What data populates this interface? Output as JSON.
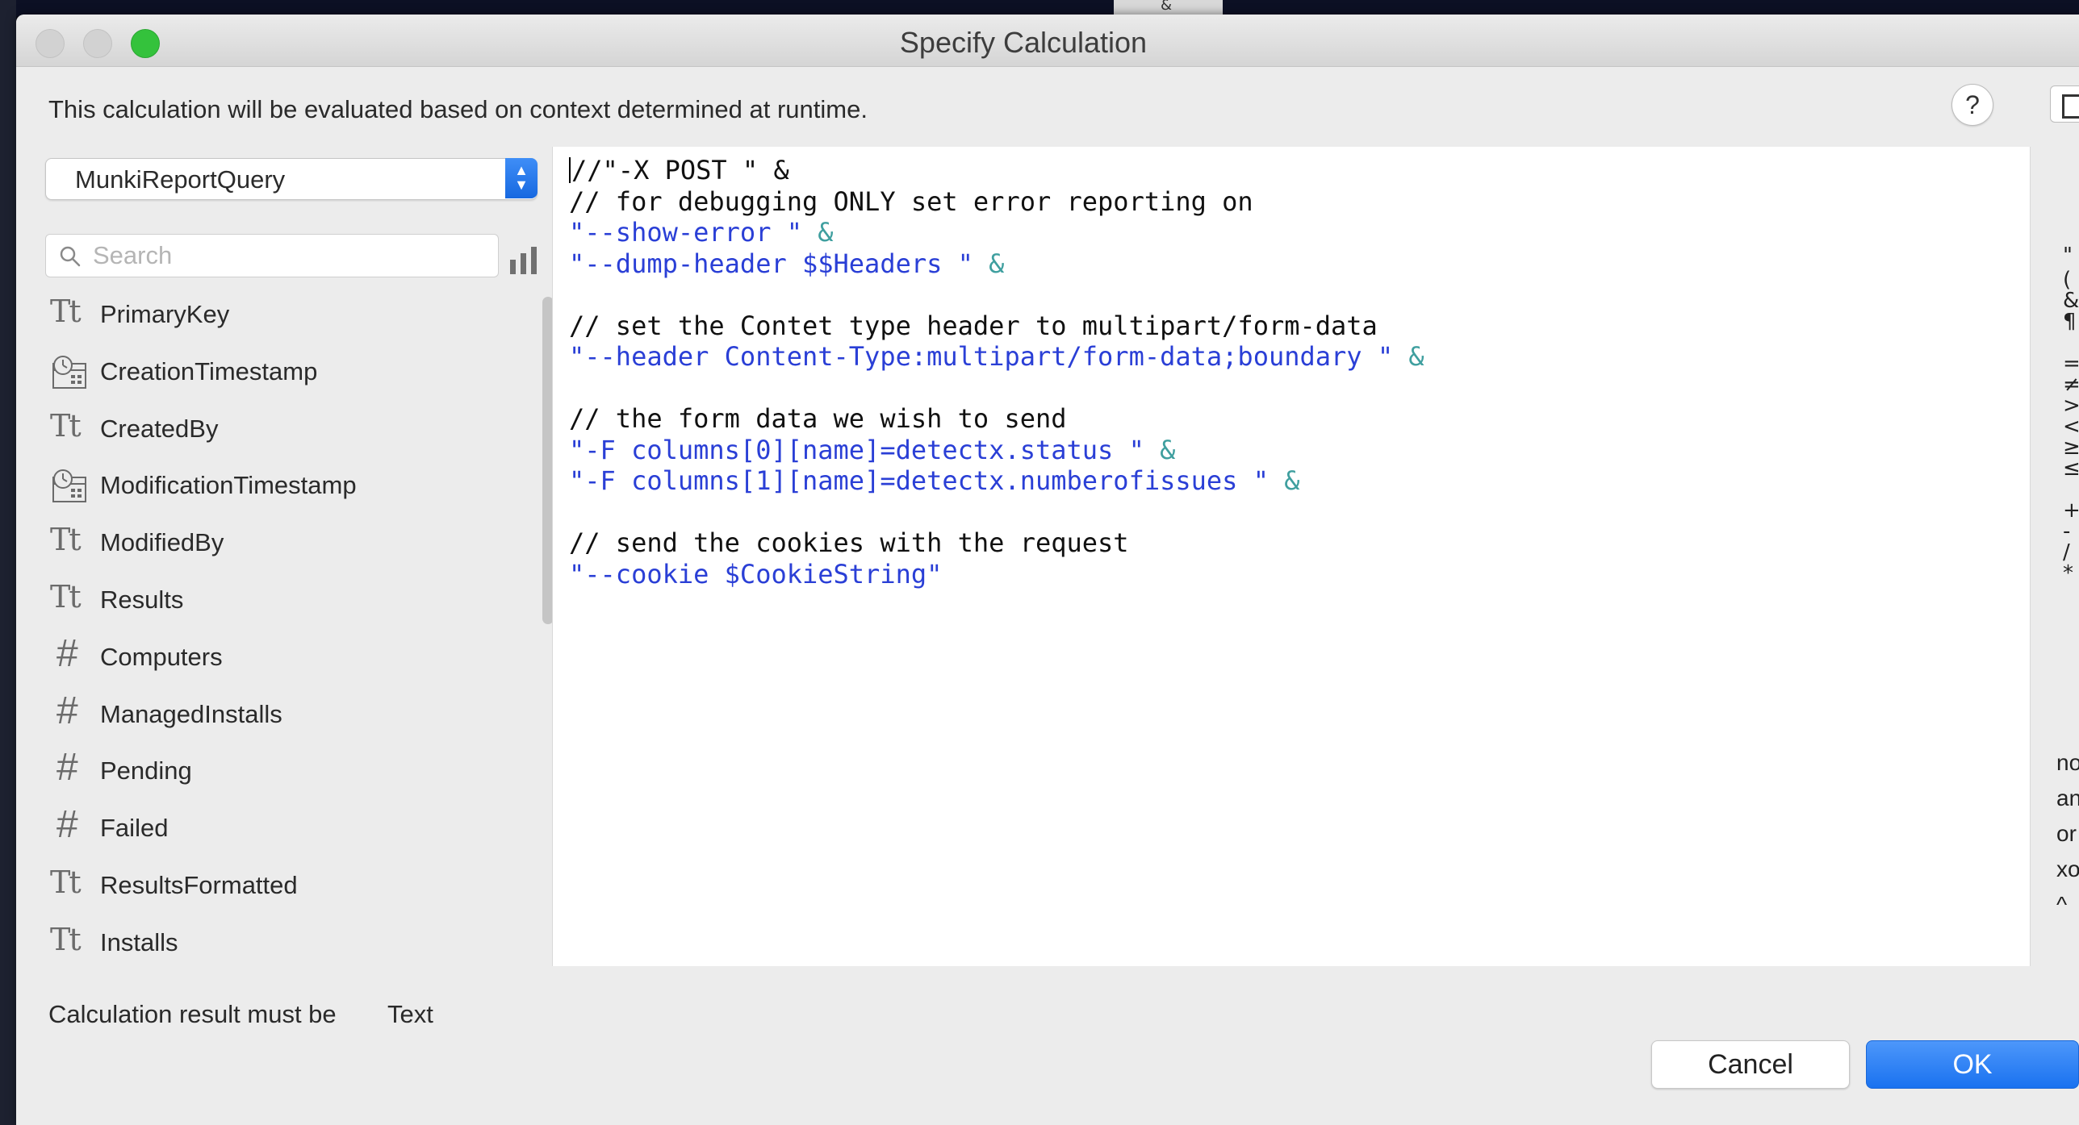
{
  "background": {
    "tab_glyph": "&"
  },
  "window": {
    "title": "Specify Calculation",
    "context_note": "This calculation will be evaluated based on context determined at runtime.",
    "help_label": "?"
  },
  "table_selector": {
    "value": "MunkiReportQuery",
    "stepper_icon": "up-down-chevron-icon"
  },
  "search": {
    "placeholder": "Search",
    "value": ""
  },
  "fields": [
    {
      "name": "PrimaryKey",
      "type": "text",
      "icon": "text-field-icon"
    },
    {
      "name": "CreationTimestamp",
      "type": "timestamp",
      "icon": "timestamp-field-icon"
    },
    {
      "name": "CreatedBy",
      "type": "text",
      "icon": "text-field-icon"
    },
    {
      "name": "ModificationTimestamp",
      "type": "timestamp",
      "icon": "timestamp-field-icon"
    },
    {
      "name": "ModifiedBy",
      "type": "text",
      "icon": "text-field-icon"
    },
    {
      "name": "Results",
      "type": "text",
      "icon": "text-field-icon"
    },
    {
      "name": "Computers",
      "type": "number",
      "icon": "number-field-icon"
    },
    {
      "name": "ManagedInstalls",
      "type": "number",
      "icon": "number-field-icon"
    },
    {
      "name": "Pending",
      "type": "number",
      "icon": "number-field-icon"
    },
    {
      "name": "Failed",
      "type": "number",
      "icon": "number-field-icon"
    },
    {
      "name": "ResultsFormatted",
      "type": "text",
      "icon": "text-field-icon"
    },
    {
      "name": "Installs",
      "type": "text",
      "icon": "text-field-icon"
    }
  ],
  "code_lines": [
    [
      {
        "text": "//\"-X POST \" &",
        "style": "black"
      }
    ],
    [
      {
        "text": "// for debugging ONLY set error reporting on",
        "style": "black"
      }
    ],
    [
      {
        "text": "\"--show-error \" ",
        "style": "blue"
      },
      {
        "text": "&",
        "style": "amp"
      }
    ],
    [
      {
        "text": "\"--dump-header $$Headers \" ",
        "style": "blue"
      },
      {
        "text": "&",
        "style": "amp"
      }
    ],
    [],
    [
      {
        "text": "// set the Contet type header to multipart/form-data",
        "style": "black"
      }
    ],
    [
      {
        "text": "\"--header Content-Type:multipart/form-data;boundary \" ",
        "style": "blue"
      },
      {
        "text": "&",
        "style": "amp"
      }
    ],
    [],
    [
      {
        "text": "// the form data we wish to send",
        "style": "black"
      }
    ],
    [
      {
        "text": "\"-F columns[0][name]=detectx.status \" ",
        "style": "blue"
      },
      {
        "text": "&",
        "style": "amp"
      }
    ],
    [
      {
        "text": "\"-F columns[1][name]=detectx.numberofissues \" ",
        "style": "blue"
      },
      {
        "text": "&",
        "style": "amp"
      }
    ],
    [],
    [
      {
        "text": "// send the cookies with the request",
        "style": "black"
      }
    ],
    [
      {
        "text": "\"--cookie $CookieString\"",
        "style": "blue"
      }
    ]
  ],
  "operators": {
    "symbols": [
      "\" \"",
      "( )",
      "&",
      "¶",
      "=",
      "≠",
      ">",
      "<",
      "≥",
      "≤",
      "+",
      "-",
      "/",
      "*"
    ],
    "words": [
      "not",
      "and",
      "or",
      "xor",
      "^"
    ]
  },
  "footer": {
    "result_label": "Calculation result must be",
    "result_type": "Text",
    "cancel_label": "Cancel",
    "ok_label": "OK"
  },
  "colors": {
    "code_string": "#2a3fd6",
    "code_operator": "#3f9f9f",
    "ok_button": "#1a72f0",
    "zoom_button": "#34c23c"
  }
}
